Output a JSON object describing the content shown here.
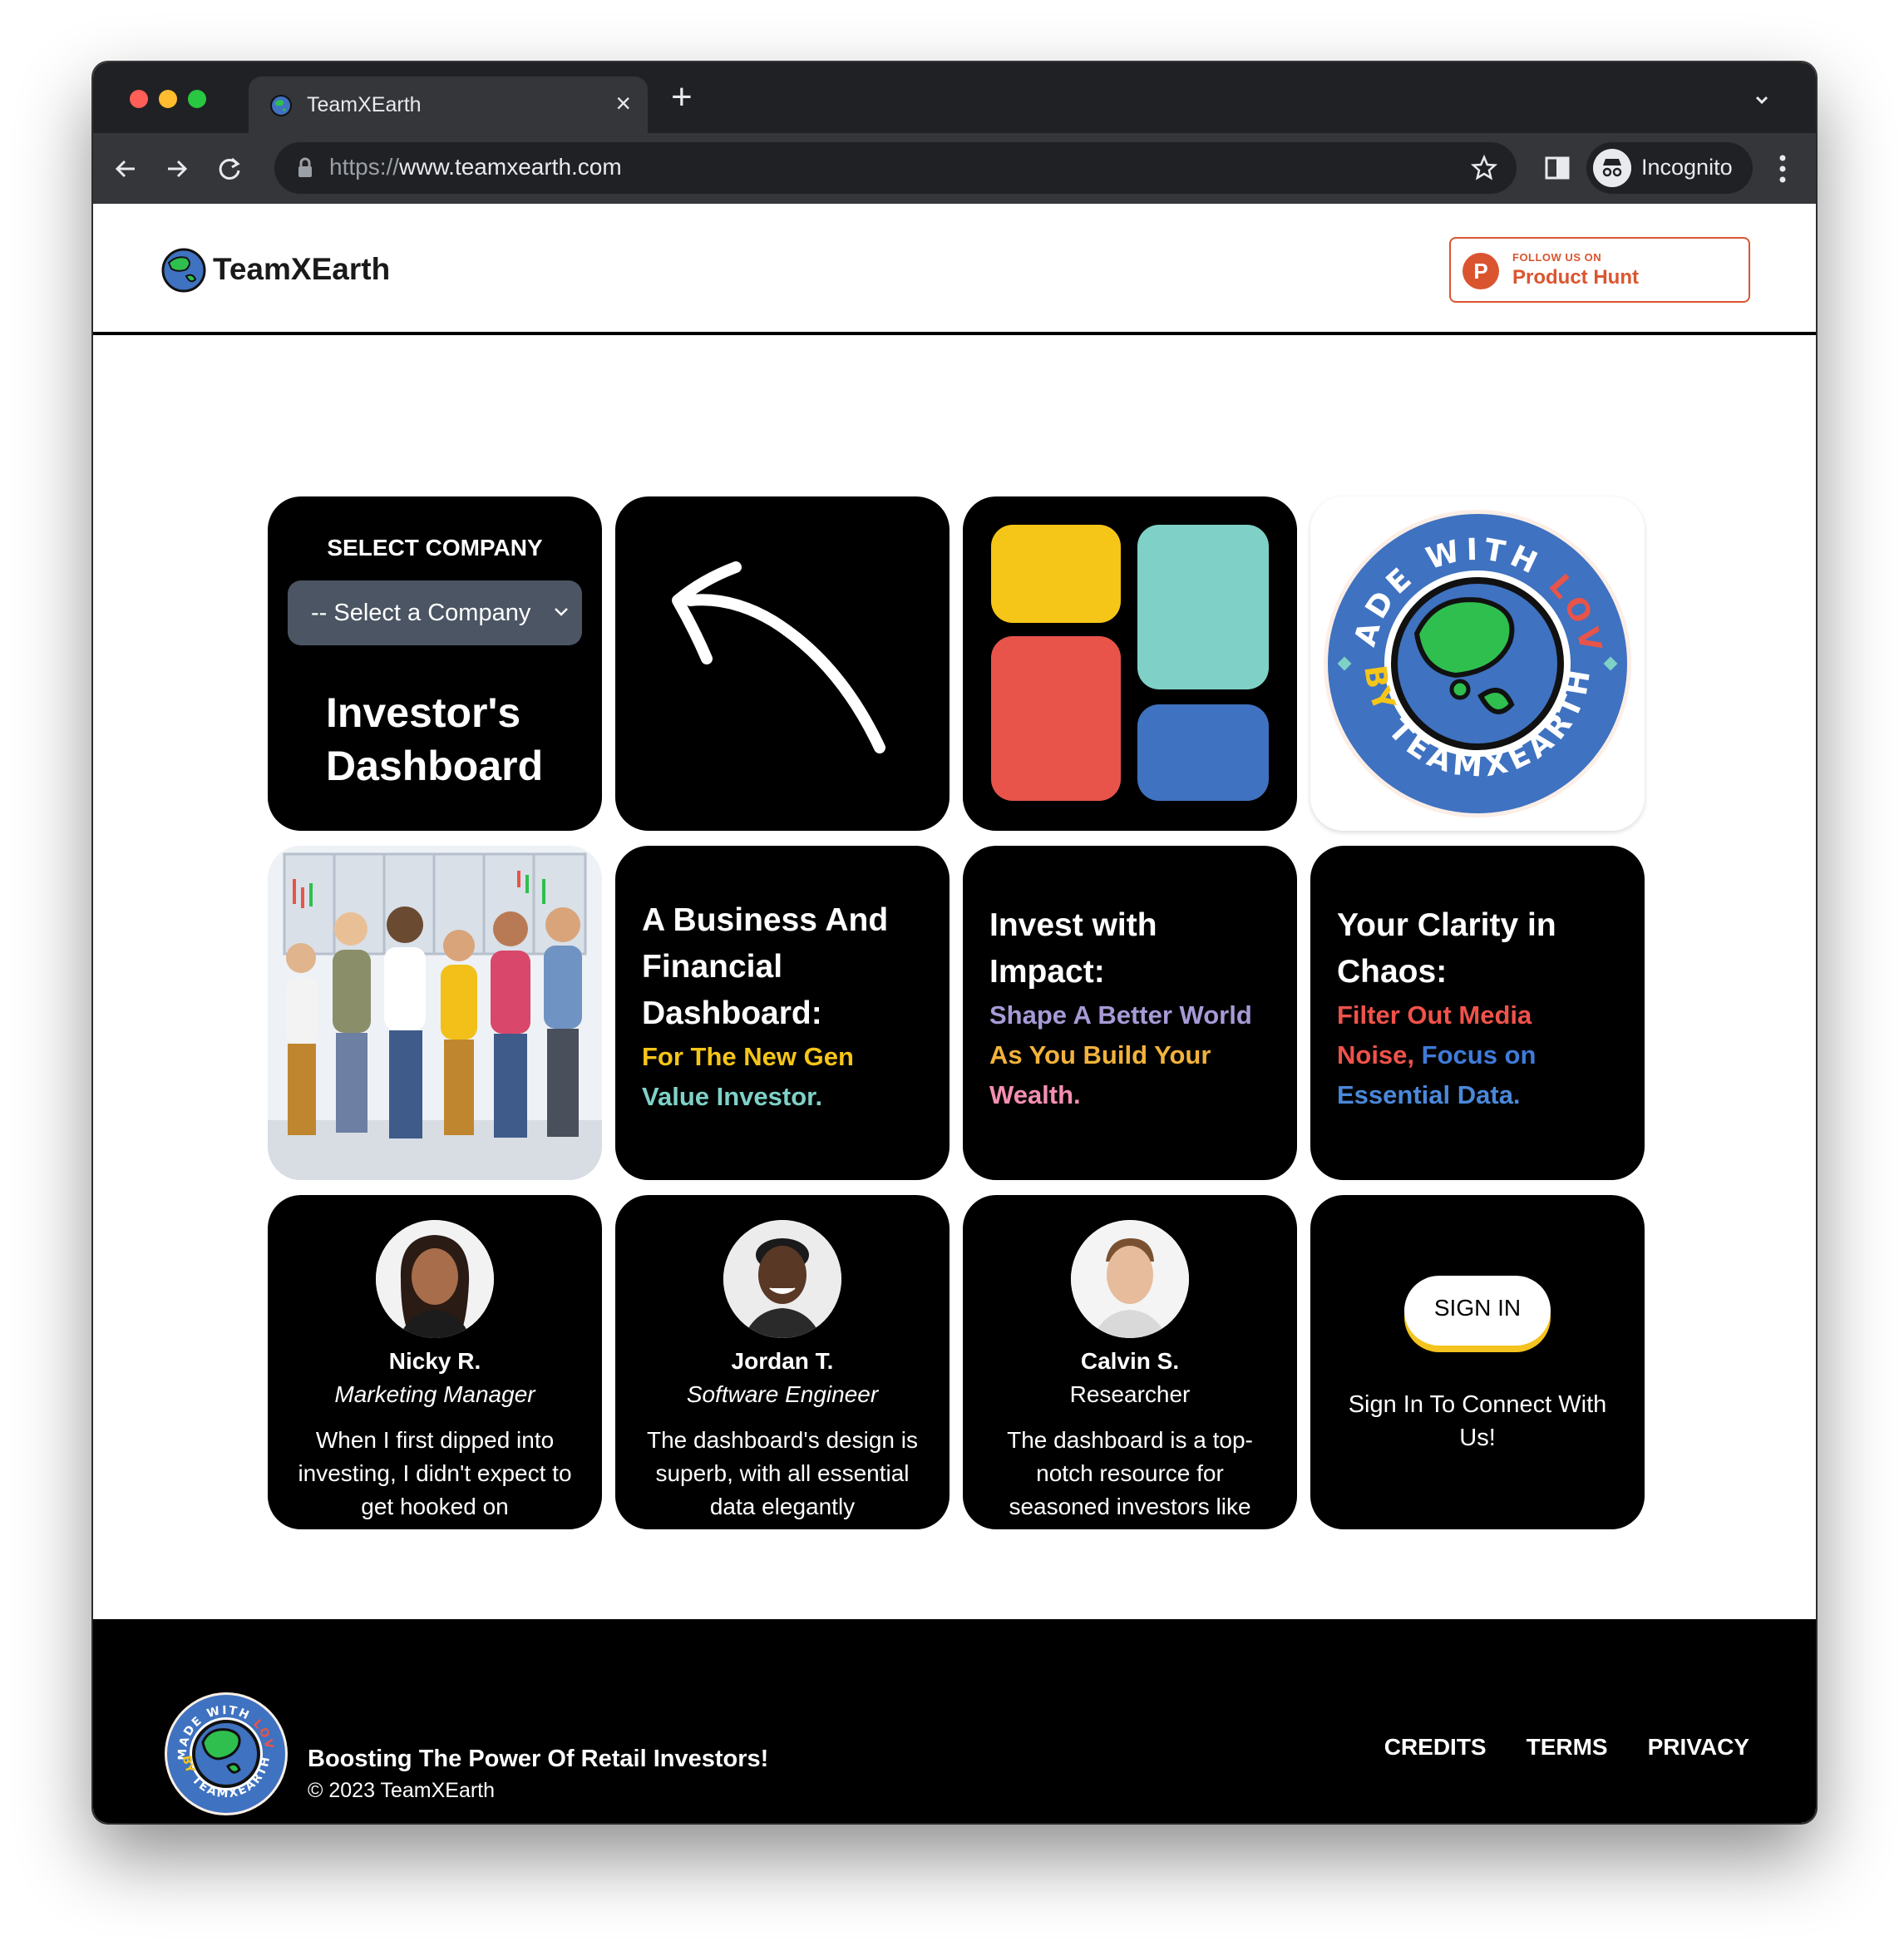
{
  "browser": {
    "tab_title": "TeamXEarth",
    "url_protocol": "https://",
    "url_host": "www.teamxearth.com",
    "profile_label": "Incognito"
  },
  "header": {
    "brand_name": "TeamXEarth",
    "product_hunt": {
      "small": "FOLLOW US ON",
      "big": "Product Hunt"
    }
  },
  "dashboard_card": {
    "select_label": "SELECT COMPANY",
    "select_value": "-- Select a Company",
    "title_line1": "Investor's",
    "title_line2": "Dashboard"
  },
  "badge": {
    "top_text": "MADE WITH LOVE",
    "bottom_text": "BY TEAMXEARTH"
  },
  "features": [
    {
      "heading": [
        "A Business And",
        "Financial",
        "Dashboard:"
      ],
      "sub": [
        {
          "text": "For The New Gen",
          "color": "#f5c518"
        },
        {
          "text": "Value Investor.",
          "color": "#7fd1c7"
        }
      ]
    },
    {
      "heading": [
        "Invest with",
        "Impact:"
      ],
      "sub": [
        {
          "text": "Shape A Better World",
          "color": "#a79ad6"
        },
        {
          "text": "As You Build Your",
          "color": "#f2b23b"
        },
        {
          "text": "Wealth.",
          "color": "#f48fb1"
        }
      ]
    },
    {
      "heading": [
        "Your Clarity in",
        "Chaos:"
      ],
      "sub": [
        {
          "text": "Filter Out Media",
          "color": "#f0524a"
        },
        {
          "text": "Noise, Focus on",
          "color": "#3f7bd9"
        },
        {
          "text": "Essential Data.",
          "color": "#4a88d9"
        }
      ]
    }
  ],
  "testimonials": [
    {
      "name": "Nicky R.",
      "role": "Marketing Manager",
      "quote": "When I first dipped into investing, I didn't expect to get hooked on"
    },
    {
      "name": "Jordan T.",
      "role": "Software Engineer",
      "quote": "The dashboard's design is superb, with all essential data elegantly"
    },
    {
      "name": "Calvin S.",
      "role": "Researcher",
      "quote": "The dashboard is a top-notch resource for seasoned investors like"
    }
  ],
  "signin": {
    "button": "SIGN IN",
    "text": "Sign In To Connect With Us!"
  },
  "footer": {
    "tagline": "Boosting The Power Of Retail Investors!",
    "copyright": "© 2023 TeamXEarth",
    "links": [
      "CREDITS",
      "TERMS",
      "PRIVACY"
    ]
  },
  "colors": {
    "tile_yellow": "#f5c518",
    "tile_teal": "#7fd1c7",
    "tile_red": "#e8544a",
    "tile_blue": "#3f72c0",
    "signin_accent": "#f5c31d",
    "product_hunt": "#da552f"
  }
}
